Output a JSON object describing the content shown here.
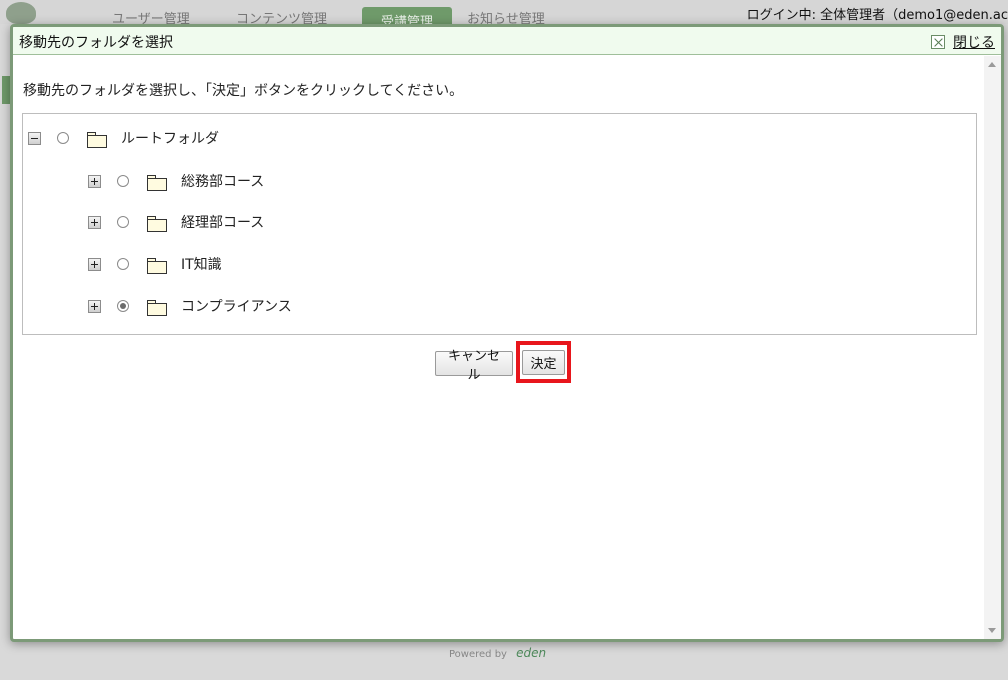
{
  "background": {
    "nav": [
      "ユーザー管理",
      "コンテンツ管理",
      "受講管理",
      "お知らせ管理"
    ],
    "login_text": "ログイン中: 全体管理者（demo1@eden.ac",
    "footer_powered": "Powered by",
    "footer_logo": "eden"
  },
  "dialog": {
    "title": "移動先のフォルダを選択",
    "close_label": "閉じる",
    "instruction": "移動先のフォルダを選択し、「決定」ボタンをクリックしてください。",
    "tree": {
      "root": {
        "label": "ルートフォルダ",
        "expanded": true,
        "selected": false
      },
      "children": [
        {
          "label": "総務部コース",
          "expanded": false,
          "selected": false
        },
        {
          "label": "経理部コース",
          "expanded": false,
          "selected": false
        },
        {
          "label": "IT知識",
          "expanded": false,
          "selected": false
        },
        {
          "label": "コンプライアンス",
          "expanded": false,
          "selected": true
        }
      ]
    },
    "buttons": {
      "cancel": "キャンセル",
      "confirm": "決定"
    }
  },
  "colors": {
    "dialog_border": "#7c9a78",
    "titlebar_bg": "#f0fbee",
    "highlight": "#e8161c"
  }
}
